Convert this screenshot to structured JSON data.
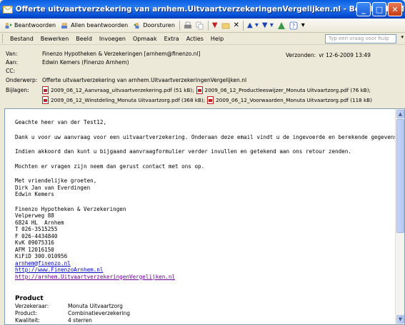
{
  "window": {
    "title": "Offerte uitvaartverzekering van arnhem.UitvaartverzekeringenVergelijken.nl - Bericht (HTML)",
    "buttons": [
      "_",
      "□",
      "✕"
    ]
  },
  "toolbar": {
    "reply": "Beantwoorden",
    "reply_all": "Allen beantwoorden",
    "forward": "Doorsturen"
  },
  "menu": {
    "items": [
      "Bestand",
      "Bewerken",
      "Beeld",
      "Invoegen",
      "Opmaak",
      "Extra",
      "Acties",
      "Help"
    ],
    "help_placeholder": "Typ een vraag voor hulp"
  },
  "header": {
    "from_label": "Van:",
    "from": "Finenzo Hypotheken & Verzekeringen [arnhem@finenzo.nl]",
    "to_label": "Aan:",
    "to": "Edwin Kemers (Finenzo Arnhem)",
    "cc_label": "CC:",
    "cc": "",
    "subject_label": "Onderwerp:",
    "subject": "Offerte uitvaartverzekering van arnhem.UitvaartverzekeringenVergelijken.nl",
    "sent_label": "Verzonden:",
    "sent": "vr 12-6-2009 13:49",
    "attachments_label": "Bijlagen:",
    "attachments": [
      "2009_06_12_Aanvraag_uitvaartverzekering.pdf (51 kB);",
      "2009_06_12_Productleeswijzer_Monuta Uitvaartzorg.pdf (76 kB);",
      "2009_06_12_Winstdeling_Monuta Uitvaartzorg.pdf (368 kB);",
      "2009_06_12_Voorwaarden_Monuta Uitvaartzorg.pdf (118 kB)"
    ]
  },
  "body": {
    "greeting": "Geachte heer van der Test12,",
    "p1": "Dank u voor uw aanvraag voor een uitvaartverzekering. Onderaan deze email vindt u de ingevoerde en berekende gegevens.",
    "p2": "Indien akkoord dan kunt u bijgaand aanvraagformulier verder invullen en getekend aan ons retour zenden.",
    "p3": "Mochten er vragen zijn neem dan gerust contact met ons op.",
    "closing": "Met vriendelijke groeten,",
    "sig1": "Dirk Jan van Everdingen",
    "sig2": "Edwin Kemers",
    "company": "Finenzo Hypotheken & Verzekeringen",
    "street": "Velperweg 88",
    "city": "6824 HL  Arnhem",
    "phone": "T 026-3515255",
    "fax": "F 026-4434840",
    "kvk": "KvK 09075316",
    "afm": "AFM 12016150",
    "kifid": "KiFiD 300.010956",
    "email_link": "arnhem@finenzo.nl",
    "site_link": "http://www.FinenzoArnhem.nl",
    "site2_link": "http://arnhem.UitvaartverzekeringenVergelijken.nl",
    "product_title": "Product",
    "product_rows": [
      {
        "label": "Verzekeraar:",
        "value": "Monuta Uitvaartzorg"
      },
      {
        "label": "Product:",
        "value": "Combinatieverzekering"
      },
      {
        "label": "Kwaliteit:",
        "value": "4 sterren"
      }
    ]
  }
}
